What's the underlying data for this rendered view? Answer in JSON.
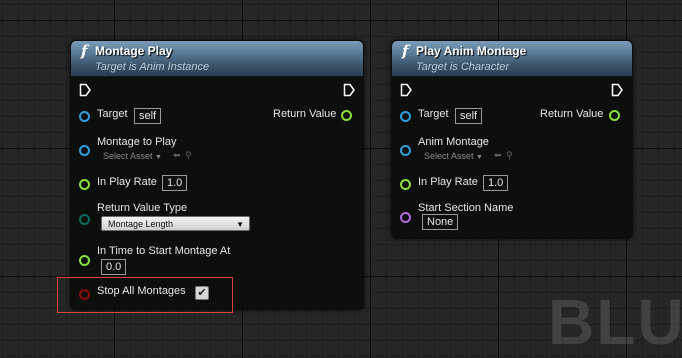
{
  "background": {
    "watermark": "BLUE"
  },
  "nodes": [
    {
      "title": "Montage Play",
      "subtitle": "Target is Anim Instance",
      "header_color": "#5e7f9c",
      "pins": {
        "target": {
          "label": "Target",
          "value": "self"
        },
        "return_value": {
          "label": "Return Value"
        },
        "montage_to_play": {
          "label": "Montage to Play",
          "select_asset": "Select Asset"
        },
        "in_play_rate": {
          "label": "In Play Rate",
          "value": "1.0"
        },
        "return_value_type": {
          "label": "Return Value Type",
          "selected": "Montage Length"
        },
        "in_time_to_start": {
          "label": "In Time to Start Montage At",
          "value": "0.0"
        },
        "stop_all_montages": {
          "label": "Stop All Montages",
          "checked": true
        }
      }
    },
    {
      "title": "Play Anim Montage",
      "subtitle": "Target is Character",
      "header_color": "#5e7f9c",
      "pins": {
        "target": {
          "label": "Target",
          "value": "self"
        },
        "return_value": {
          "label": "Return Value"
        },
        "anim_montage": {
          "label": "Anim Montage",
          "select_asset": "Select Asset"
        },
        "in_play_rate": {
          "label": "In Play Rate",
          "value": "1.0"
        },
        "start_section_name": {
          "label": "Start Section Name",
          "value": "None"
        }
      }
    }
  ],
  "pin_colors": {
    "object": "#2f9fe0",
    "float": "#8ae03a",
    "enum": "#0e6a5c",
    "name": "#b16ae0",
    "bool": "#8a0d0d",
    "highlight": "#d8443a"
  },
  "icons": {
    "function": "function-icon",
    "exec": "exec-arrow-icon",
    "checkbox_check": "✔"
  }
}
